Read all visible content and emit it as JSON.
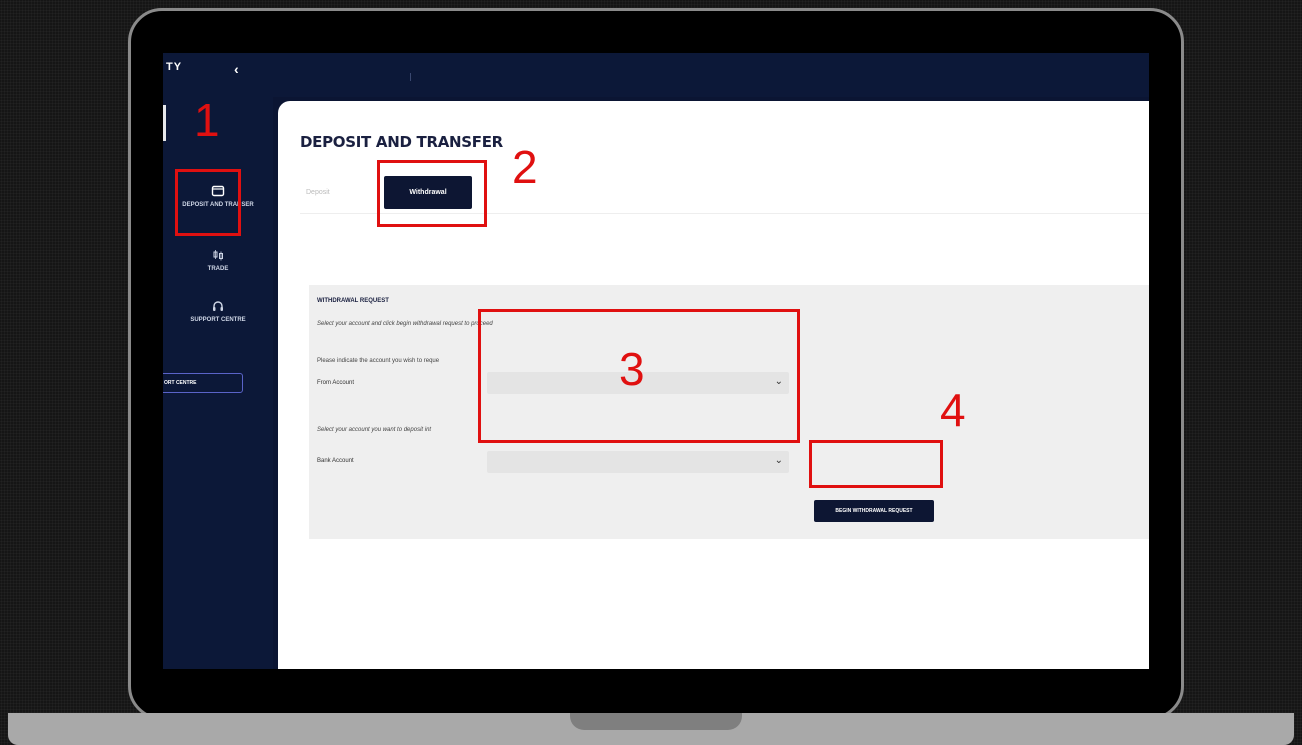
{
  "sidebar": {
    "logo_text": "TY",
    "collapse_label": "‹",
    "items": [
      {
        "label": "DEPOSIT AND TRANSER",
        "icon": "wallet-icon"
      },
      {
        "label": "TRADE",
        "icon": "candlestick-icon"
      },
      {
        "label": "SUPPORT CENTRE",
        "icon": "headset-icon"
      }
    ],
    "support_button_label": "ORT CENTRE"
  },
  "page": {
    "title": "DEPOSIT AND TRANSFER",
    "tabs": [
      {
        "label": "Deposit",
        "active": false
      },
      {
        "label": "Withdrawal",
        "active": true
      }
    ]
  },
  "form": {
    "title": "WITHDRAWAL REQUEST",
    "subtitle": "Select your account and click begin withdrawal request to proceed",
    "from_prompt": "Please indicate the account you wish to reque",
    "from_label": "From Account",
    "from_value": "",
    "deposit_prompt": "Select your account you want to deposit int",
    "bank_label": "Bank Account",
    "bank_value": "",
    "submit_label": "BEGIN WITHDRAWAL REQUEST"
  },
  "annotations": [
    "1",
    "2",
    "3",
    "4"
  ],
  "colors": {
    "navy": "#0c1838",
    "annotation_red": "#e01010",
    "card_bg": "#efefef"
  }
}
